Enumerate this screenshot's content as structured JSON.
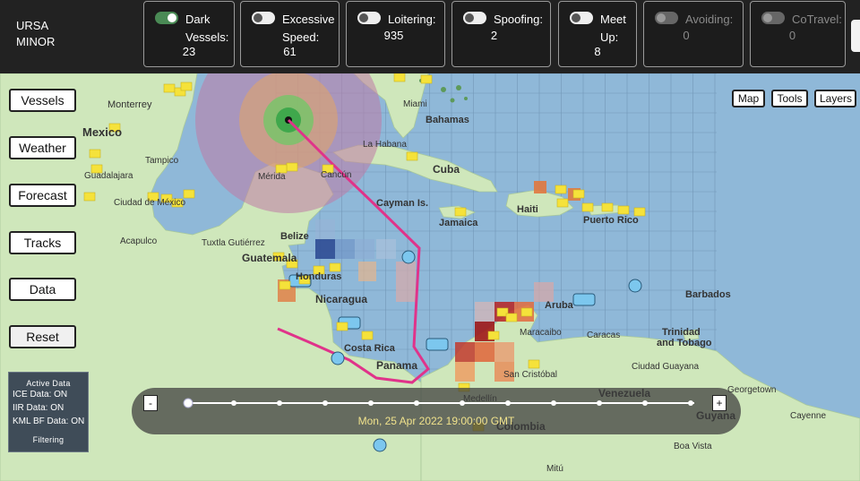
{
  "brand": {
    "line1": "URSA",
    "line2": "MINOR"
  },
  "cards": [
    {
      "name": "dark-vessels",
      "label1": "Dark",
      "label2": "Vessels:",
      "value": "23",
      "state": "on"
    },
    {
      "name": "excessive-speed",
      "label1": "Excessive",
      "label2": "Speed:",
      "value": "61",
      "state": "off"
    },
    {
      "name": "loitering",
      "label1": "Loitering:",
      "label2": "",
      "value": "935",
      "state": "off"
    },
    {
      "name": "spoofing",
      "label1": "Spoofing:",
      "label2": "",
      "value": "2",
      "state": "off"
    },
    {
      "name": "meet-up",
      "label1": "Meet",
      "label2": "Up:",
      "value": "8",
      "state": "off"
    },
    {
      "name": "avoiding",
      "label1": "Avoiding:",
      "label2": "",
      "value": "0",
      "state": "disabled"
    },
    {
      "name": "cotravel",
      "label1": "CoTravel:",
      "label2": "",
      "value": "0",
      "state": "disabled"
    }
  ],
  "left_buttons": [
    "Vessels",
    "Weather",
    "Forecast",
    "Tracks",
    "Data",
    "Reset"
  ],
  "right_buttons": [
    "Map",
    "Tools",
    "Layers"
  ],
  "active_data": {
    "header": "Active Data",
    "rows": [
      "ICE Data: ON",
      "IIR Data: ON",
      "KML BF Data: ON"
    ],
    "footer": "Filtering"
  },
  "timeline": {
    "minus": "-",
    "plus": "+",
    "time": "Mon, 25 Apr 2022 19:00:00 GMT"
  },
  "map_labels": [
    "Monterrey",
    "Mexico",
    "Tampico",
    "Guadalajara",
    "Ciudad de México",
    "Acapulco",
    "Tuxtla Gutiérrez",
    "Mérida",
    "Cancún",
    "Miami",
    "Bahamas",
    "La Habana",
    "Cuba",
    "Cayman Is.",
    "Jamaica",
    "Haiti",
    "Puerto Rico",
    "Belize",
    "Guatemala",
    "Honduras",
    "Nicaragua",
    "Costa Rica",
    "Panama",
    "Aruba",
    "Maracaibo",
    "Caracas",
    "Barbados",
    "Trinidad",
    "and Tobago",
    "Medellín",
    "Colombia",
    "San Cristóbal",
    "Ciudad Guayana",
    "Venezuela",
    "Georgetown",
    "Guyana",
    "Cayenne",
    "Boa Vista",
    "Mitú"
  ],
  "colors": {
    "topbar": "#222222",
    "sea": "#8fb8d8",
    "land": "#cde6b8",
    "track": "#e0338a",
    "flag": "#f5e23a"
  }
}
